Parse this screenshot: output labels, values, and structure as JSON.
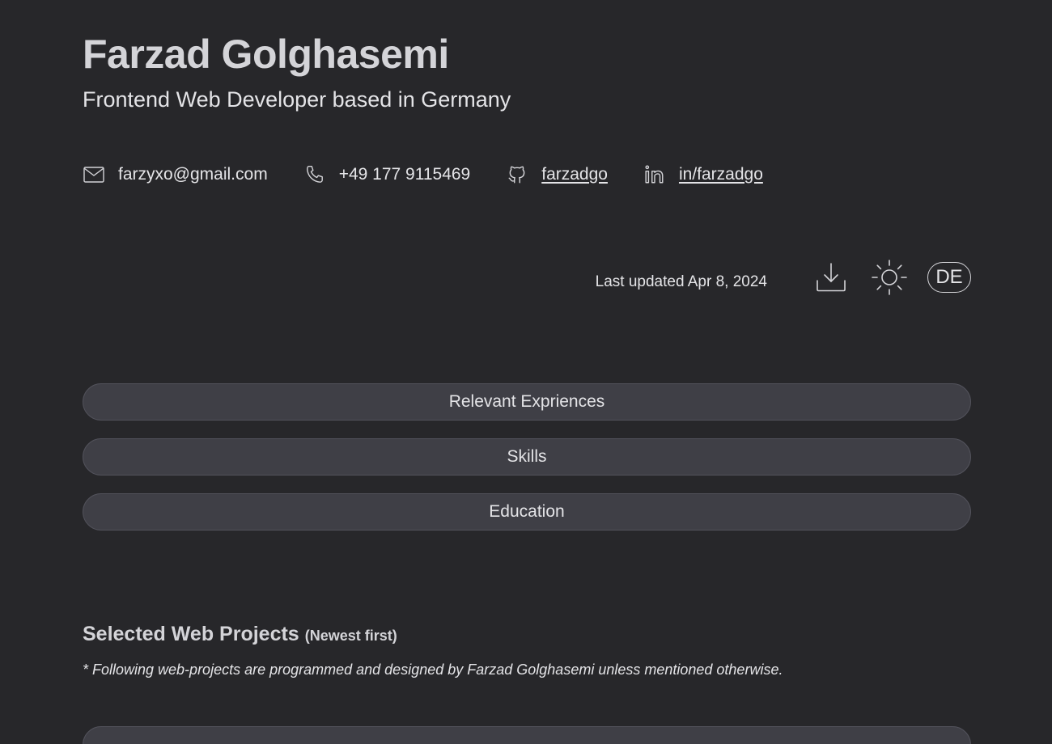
{
  "header": {
    "name": "Farzad Golghasemi",
    "subtitle": "Frontend Web Developer based in Germany"
  },
  "contacts": {
    "email": {
      "icon": "mail-icon",
      "text": "farzyxo@gmail.com"
    },
    "phone": {
      "icon": "phone-icon",
      "text": "+49 177 9115469"
    },
    "github": {
      "icon": "github-icon",
      "text": "farzadgo"
    },
    "linkedin": {
      "icon": "linkedin-icon",
      "text": "in/farzadgo"
    }
  },
  "toolbar": {
    "last_updated": "Last updated Apr 8, 2024",
    "download_icon": "download-icon",
    "theme_icon": "sun-icon",
    "language_label": "DE"
  },
  "sections": {
    "experiences": "Relevant Expriences",
    "skills": "Skills",
    "education": "Education"
  },
  "projects": {
    "title": "Selected Web Projects",
    "note": "(Newest first)",
    "disclaimer": "* Following web-projects are programmed and designed by Farzad Golghasemi unless mentioned otherwise."
  },
  "colors": {
    "background": "#27272a",
    "text": "#e4e4e7",
    "button_bg": "#3f3f46",
    "button_border": "#52525b"
  }
}
